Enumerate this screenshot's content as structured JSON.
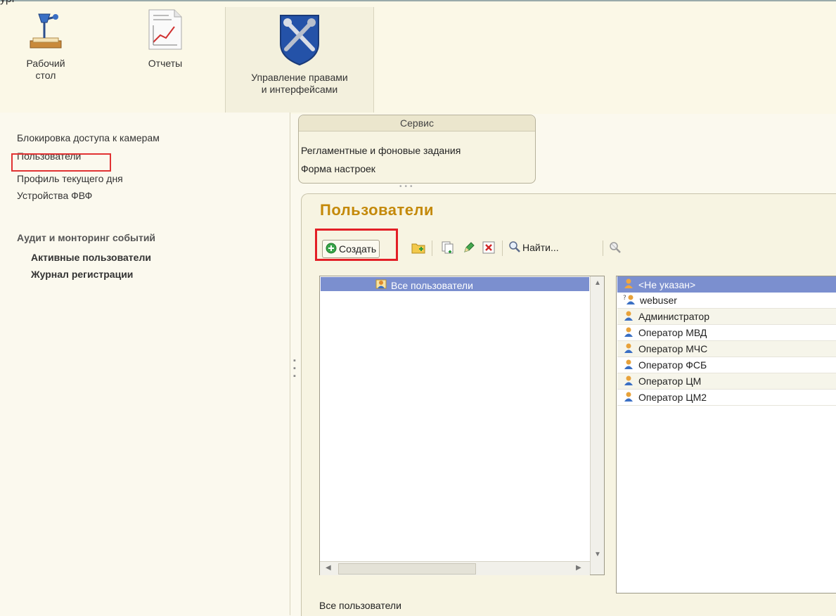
{
  "topbar": {
    "label": "урі",
    "sections": [
      {
        "label_line1": "Рабочий",
        "label_line2": "стол",
        "icon": "desk-lamp-icon"
      },
      {
        "label_line1": "Отчеты",
        "icon": "report-chart-icon"
      },
      {
        "label_line1": "Управление правами",
        "label_line2": "и интерфейсами",
        "icon": "wrench-shield-icon"
      }
    ]
  },
  "nav": {
    "items": [
      "Блокировка доступа к камерам",
      "Пользователи",
      "Профиль текущего дня",
      "Устройства ФВФ"
    ],
    "group_title": "Аудит и монторинг событий",
    "group_items": [
      "Активные пользователи",
      "Журнал регистрации"
    ]
  },
  "service": {
    "title": "Сервис",
    "links": [
      "Регламентные и фоновые задания",
      "Форма настроек"
    ]
  },
  "form": {
    "title": "Пользователи",
    "toolbar": {
      "create_label": "Создать",
      "find_label": "Найти..."
    },
    "tree": {
      "root": "Все пользователи"
    },
    "users": [
      "<Не указан>",
      "webuser",
      "Администратор",
      "Оператор МВД",
      "Оператор МЧС",
      "Оператор ФСБ",
      "Оператор ЦМ",
      "Оператор ЦМ2"
    ],
    "status": "Все пользователи"
  },
  "colors": {
    "accent_title": "#c4890a",
    "selection": "#7b8fcf",
    "highlight_red": "#e31f26"
  }
}
